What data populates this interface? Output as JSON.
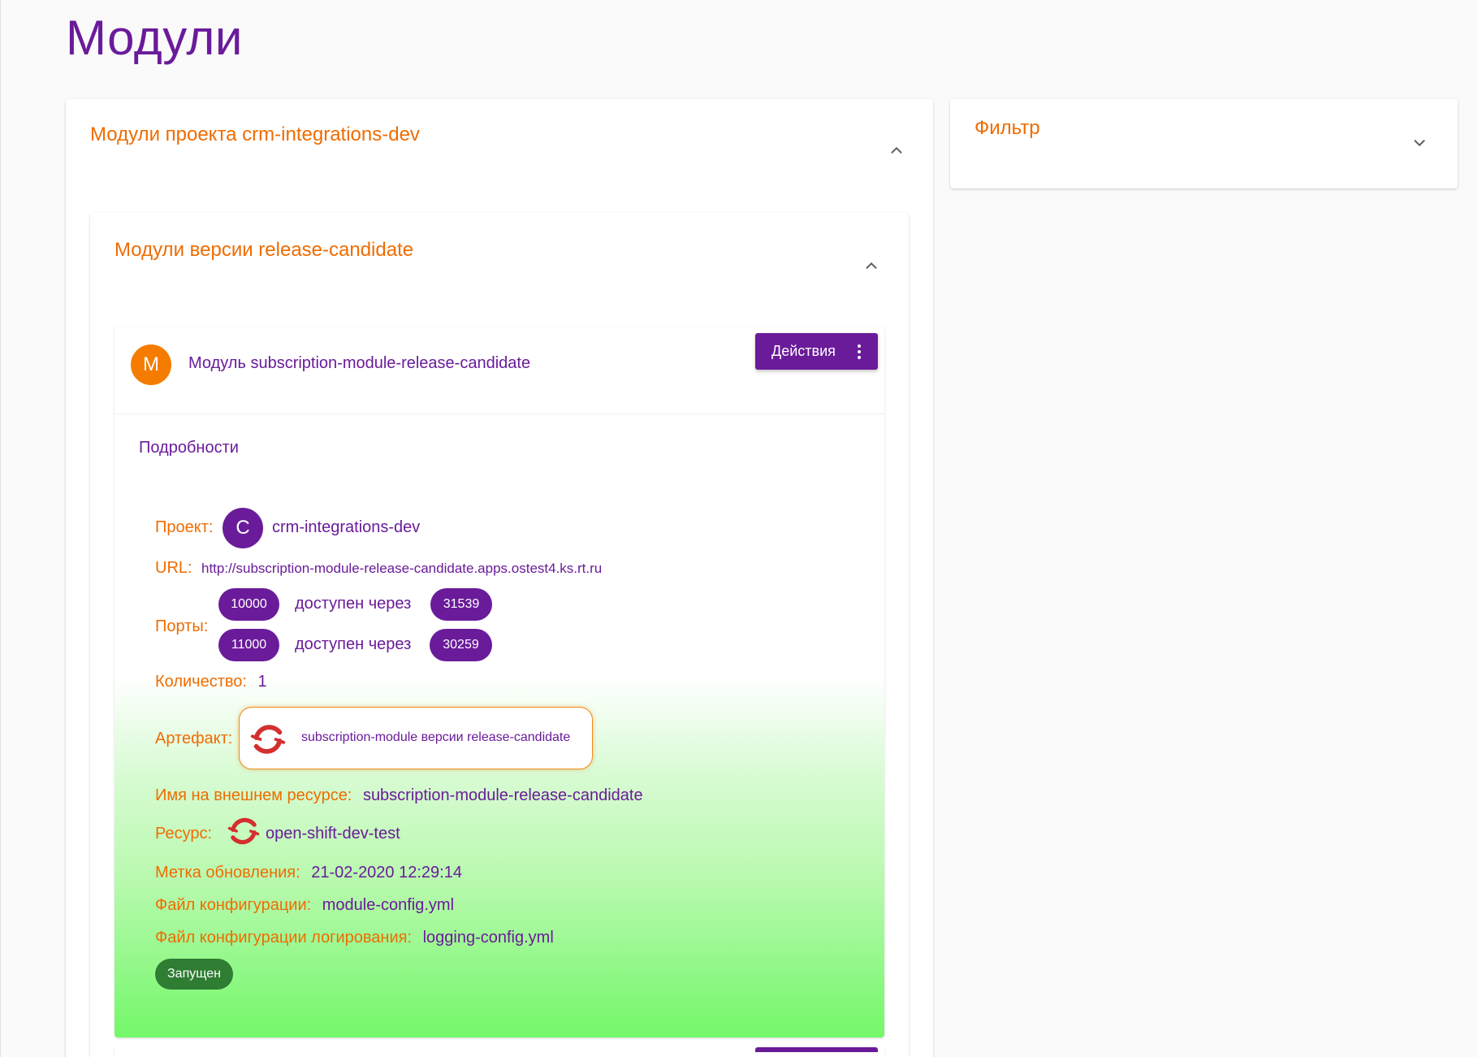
{
  "page": {
    "title": "Модули"
  },
  "project_panel": {
    "title": "Модули проекта crm-integrations-dev"
  },
  "filter_panel": {
    "title": "Фильтр"
  },
  "version_panel": {
    "title": "Модули версии release-candidate"
  },
  "module": {
    "avatar_letter": "M",
    "title": "Модуль subscription-module-release-candidate",
    "actions_label": "Действия",
    "details": {
      "title": "Подробности",
      "project": {
        "label": "Проект:",
        "avatar_letter": "C",
        "value": "crm-integrations-dev"
      },
      "url": {
        "label": "URL:",
        "value": "http://subscription-module-release-candidate.apps.ostest4.ks.rt.ru"
      },
      "ports": {
        "label": "Порты:",
        "items": [
          {
            "port": "10000",
            "via": "доступен через",
            "external": "31539"
          },
          {
            "port": "11000",
            "via": "доступен через",
            "external": "30259"
          }
        ]
      },
      "count": {
        "label": "Количество:",
        "value": "1"
      },
      "artifact": {
        "label": "Артефакт:",
        "value": "subscription-module версии release-candidate",
        "icon": "openshift-icon"
      },
      "external_name": {
        "label": "Имя на внешнем ресурсе:",
        "value": "subscription-module-release-candidate"
      },
      "resource": {
        "label": "Ресурс:",
        "value": "open-shift-dev-test",
        "icon": "openshift-icon"
      },
      "update_mark": {
        "label": "Метка обновления:",
        "value": "21-02-2020 12:29:14"
      },
      "config_file": {
        "label": "Файл конфигурации:",
        "value": "module-config.yml"
      },
      "logging_config": {
        "label": "Файл конфигурации логирования:",
        "value": "logging-config.yml"
      },
      "status": "Запущен"
    }
  },
  "colors": {
    "primary": "#6a1b9a",
    "accent": "#ef6c00",
    "module_avatar": "#f57c00",
    "status_running": "#2e7d32",
    "openshift_red": "#d32f2f",
    "gradient_bottom": "#74f86a"
  }
}
